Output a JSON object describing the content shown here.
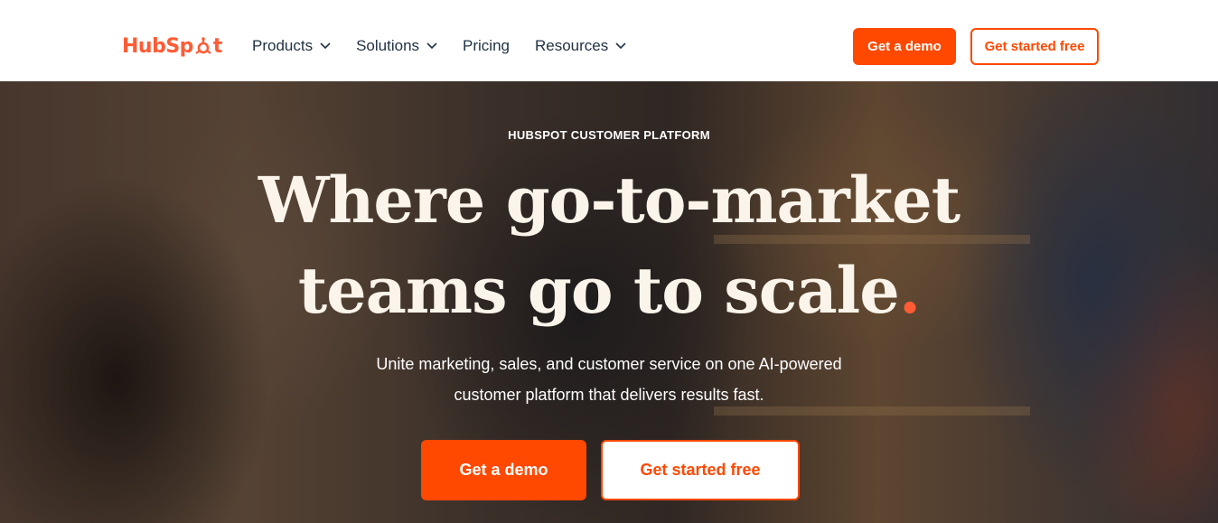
{
  "brand": {
    "name_part1": "Hub",
    "name_part2": "Sp",
    "name_part3": "t",
    "accent_color": "#ff5c35",
    "button_color": "#ff4800",
    "text_color": "#213343"
  },
  "nav": {
    "items": [
      {
        "label": "Products",
        "has_dropdown": true
      },
      {
        "label": "Solutions",
        "has_dropdown": true
      },
      {
        "label": "Pricing",
        "has_dropdown": false
      },
      {
        "label": "Resources",
        "has_dropdown": true
      }
    ],
    "demo_label": "Get a demo",
    "free_label": "Get started free"
  },
  "hero": {
    "eyebrow": "HUBSPOT CUSTOMER PLATFORM",
    "headline_line1": "Where go-to-market",
    "headline_line2": "teams go to scale",
    "headline_dot": ".",
    "subhead_line1": "Unite marketing, sales, and customer service on one AI-powered",
    "subhead_line2": "customer platform that delivers results fast.",
    "demo_label": "Get a demo",
    "free_label": "Get started free"
  }
}
